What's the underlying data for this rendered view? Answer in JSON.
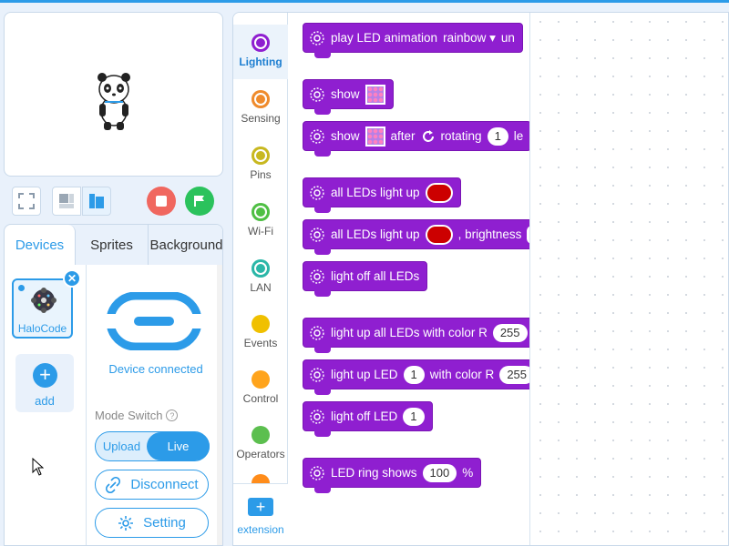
{
  "stage": {
    "controls": {
      "fullscreen_icon": "fullscreen-icon",
      "small_stage_icon": "small-stage-icon",
      "large_stage_icon": "large-stage-icon",
      "stop_color": "#f0675f",
      "go_color": "#2bc25c"
    }
  },
  "device_panel": {
    "tabs": [
      "Devices",
      "Sprites",
      "Background"
    ],
    "active_tab": "Devices",
    "device": {
      "name": "HaloCode",
      "connected": true
    },
    "add_label": "add",
    "status": "Device connected",
    "mode_label": "Mode Switch",
    "mode_options": {
      "upload": "Upload",
      "live": "Live"
    },
    "active_mode": "Live",
    "disconnect_label": "Disconnect",
    "setting_label": "Setting"
  },
  "categories": [
    {
      "label": "Lighting",
      "color": "#8f1fd0",
      "active": true
    },
    {
      "label": "Sensing",
      "color": "#ef8b2c"
    },
    {
      "label": "Pins",
      "color": "#c8b820"
    },
    {
      "label": "Wi-Fi",
      "color": "#4fbf44"
    },
    {
      "label": "LAN",
      "color": "#2bb7a8"
    },
    {
      "label": "Events",
      "color": "#f0c000"
    },
    {
      "label": "Control",
      "color": "#ffa41c"
    },
    {
      "label": "Operators",
      "color": "#5cbf4f"
    }
  ],
  "extension_label": "extension",
  "blocks": {
    "b1": {
      "t1": "play LED animation",
      "dd": "rainbow ▾",
      "t2": "un"
    },
    "b2": {
      "t1": "show"
    },
    "b3": {
      "t1": "show",
      "t2": "after",
      "t3": "rotating",
      "v1": "1",
      "t4": "le"
    },
    "b4": {
      "t1": "all LEDs light up"
    },
    "b5": {
      "t1": "all LEDs light up",
      "t2": ", brightness"
    },
    "b6": {
      "t1": "light off all LEDs"
    },
    "b7": {
      "t1": "light up all LEDs with color R",
      "v1": "255"
    },
    "b8": {
      "t1": "light up LED",
      "v1": "1",
      "t2": "with color R",
      "v2": "255"
    },
    "b9": {
      "t1": "light off LED",
      "v1": "1"
    },
    "b10": {
      "t1": "LED ring shows",
      "v1": "100",
      "t2": "%"
    }
  },
  "colors": {
    "accent": "#2c9be8",
    "block": "#8f1fd0",
    "led_red": "#cc0000"
  }
}
